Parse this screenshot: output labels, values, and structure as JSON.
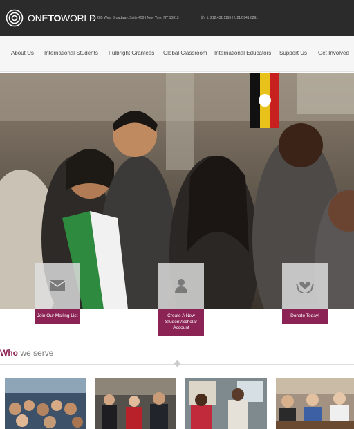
{
  "brand": {
    "pre": "ONE",
    "mid": "TO",
    "post": "WORLD"
  },
  "contact": {
    "address": "285 West Broadway, Suite 450 | New York, NY 10013",
    "phone": "t. 212.431.1195 | f. 212.941.6291",
    "address_icon": "home-icon",
    "phone_icon": "phone-icon"
  },
  "nav": [
    "About Us",
    "International Students",
    "Fulbright Grantees",
    "Global Classroom",
    "International Educators",
    "Support Us",
    "Get Involved"
  ],
  "ctas": [
    {
      "label": "Join Our Mailing List",
      "icon": "envelope-icon"
    },
    {
      "label": "Create A New Student/Scholar Account",
      "icon": "user-icon"
    },
    {
      "label": "Donate Today!",
      "icon": "hands-heart-icon"
    }
  ],
  "section": {
    "title_accent": "Who",
    "title_rest": "we serve"
  },
  "colors": {
    "accent": "#8b2355",
    "topbar": "#2b2b2b",
    "nav_bg": "#f6f6f6"
  }
}
